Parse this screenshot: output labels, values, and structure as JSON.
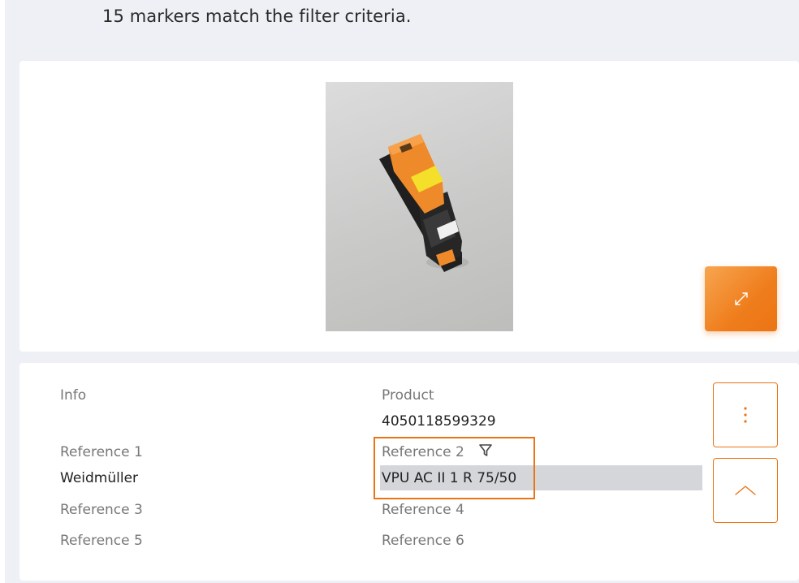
{
  "results": {
    "count_text": "15 markers match the filter criteria."
  },
  "image_card": {
    "photo_name": "product-photo",
    "expand_icon": "expand-arrows-icon"
  },
  "info": {
    "info_label": "Info",
    "product_label": "Product",
    "product_value": "4050118599329",
    "reference1_label": "Reference 1",
    "reference1_value": "Weidmüller",
    "reference2_label": "Reference 2",
    "reference2_value": "VPU AC II 1 R 75/50",
    "reference3_label": "Reference 3",
    "reference4_label": "Reference 4",
    "reference5_label": "Reference 5",
    "reference6_label": "Reference 6",
    "filter_icon": "funnel-filter-icon",
    "more_icon": "vertical-dots-icon",
    "collapse_icon": "chevron-up-icon"
  },
  "colors": {
    "accent": "#ec7414",
    "panel_background": "#eef0f5",
    "highlight": "#d4d6da"
  }
}
